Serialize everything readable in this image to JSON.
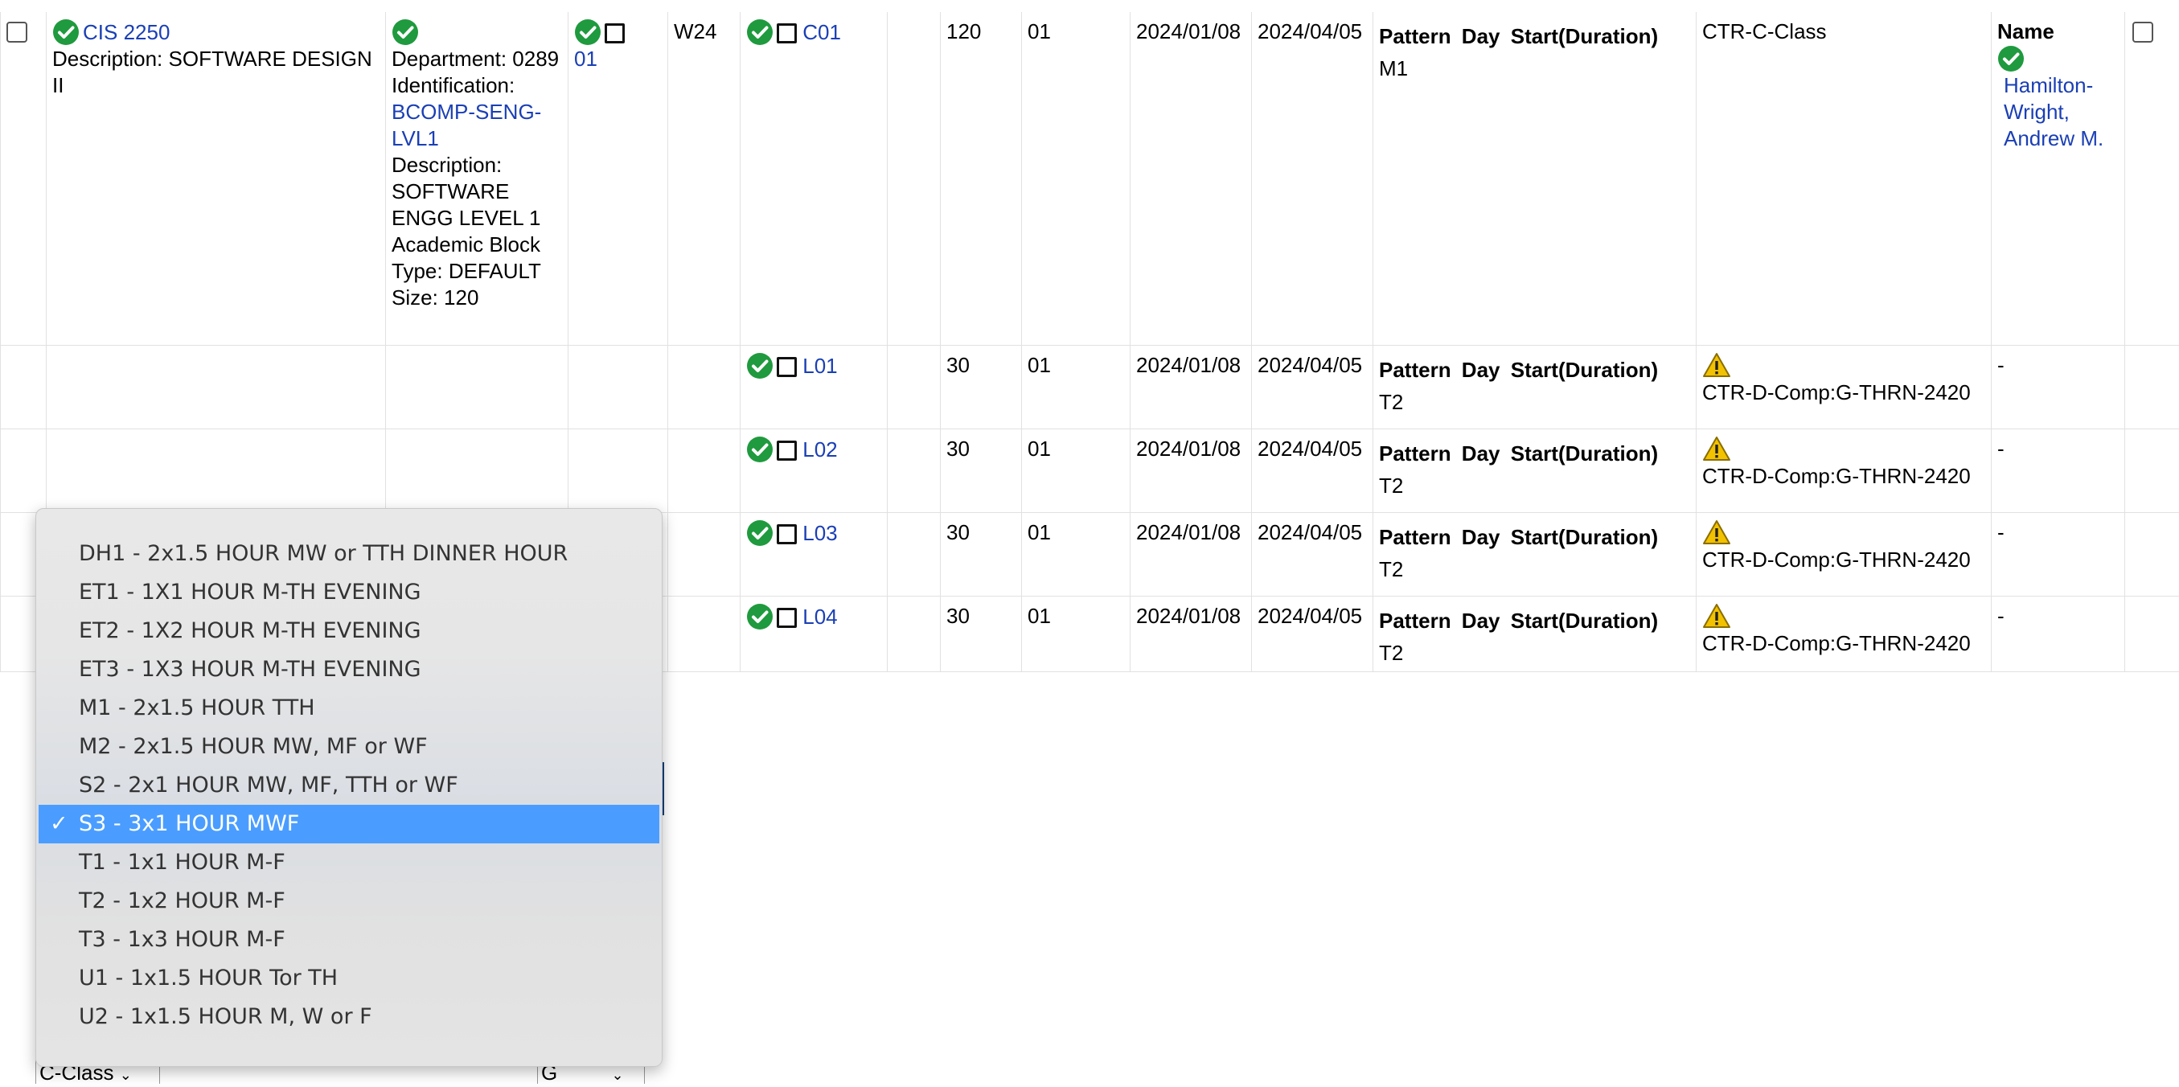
{
  "course": {
    "code": "CIS 2250",
    "description": "Description: SOFTWARE DESIGN II",
    "department": "Department: 0289",
    "identification_label": "Identification:",
    "identification_link": "BCOMP-SENG-LVL1",
    "block_description": "Description: SOFTWARE ENGG LEVEL 1",
    "block_type": "Academic Block Type: DEFAULT",
    "block_size": "Size: 120",
    "section_ref": "01",
    "term": "W24"
  },
  "pattern_header": "Pattern Day Start(Duration)",
  "instructor_header": "Name",
  "sections": [
    {
      "code": "C01",
      "cap": "120",
      "seq": "01",
      "start": "2024/01/08",
      "end": "2024/04/05",
      "pattern": "M1",
      "room": "CTR-C-Class",
      "warning": false,
      "instructor": "Hamilton-Wright, Andrew M."
    },
    {
      "code": "L01",
      "cap": "30",
      "seq": "01",
      "start": "2024/01/08",
      "end": "2024/04/05",
      "pattern": "T2",
      "room": "CTR-D-Comp:G-THRN-2420",
      "warning": true,
      "instructor": "-"
    },
    {
      "code": "L02",
      "cap": "30",
      "seq": "01",
      "start": "2024/01/08",
      "end": "2024/04/05",
      "pattern": "T2",
      "room": "CTR-D-Comp:G-THRN-2420",
      "warning": true,
      "instructor": "-"
    },
    {
      "code": "L03",
      "cap": "30",
      "seq": "01",
      "start": "2024/01/08",
      "end": "2024/04/05",
      "pattern": "T2",
      "room": "CTR-D-Comp:G-THRN-2420",
      "warning": true,
      "instructor": "-"
    },
    {
      "code": "L04",
      "cap": "30",
      "seq": "01",
      "start": "2024/01/08",
      "end": "2024/04/05",
      "pattern": "T2",
      "room": "CTR-D-Comp:G-THRN-2420",
      "warning": true,
      "instructor": "-"
    }
  ],
  "pattern_menu": {
    "selected_index": 7,
    "options": [
      "DH1 - 2x1.5 HOUR MW or TTH DINNER HOUR",
      "ET1 - 1X1 HOUR M-TH EVENING",
      "ET2 - 1X2 HOUR M-TH EVENING",
      "ET3 - 1X3 HOUR M-TH EVENING",
      "M1 - 2x1.5 HOUR TTH",
      "M2 - 2x1.5 HOUR MW, MF or WF",
      "S2 - 2x1 HOUR MW, MF, TTH or WF",
      "S3 - 3x1 HOUR MWF",
      "T1 - 1x1 HOUR M-F",
      "T2 - 1x2 HOUR M-F",
      "T3 - 1x3 HOUR M-F",
      "U1 - 1x1.5 HOUR Tor TH",
      "U2 - 1x1.5 HOUR M, W or F"
    ],
    "check_glyph": "✓"
  },
  "bottom_selects": {
    "room_type": "C-Class",
    "building": "G"
  },
  "colors": {
    "link": "#1a3fb5",
    "selected": "#4a9dff",
    "ok": "#1f9a3e",
    "warn": "#f2c200"
  }
}
